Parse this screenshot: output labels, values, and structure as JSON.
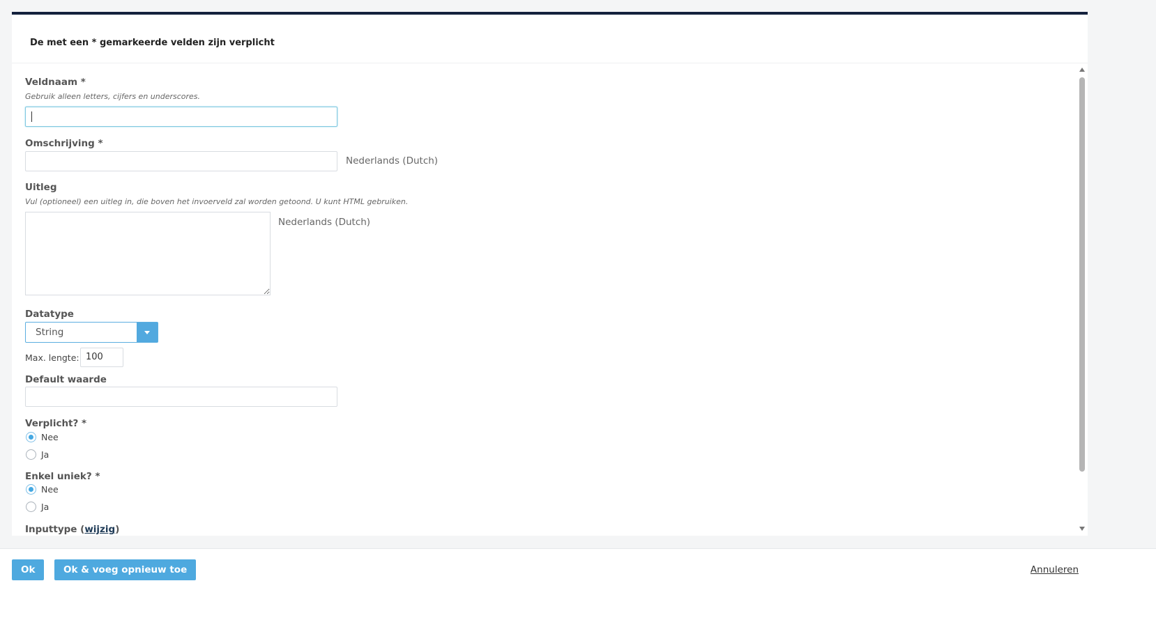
{
  "notice": "De met een * gemarkeerde velden zijn verplicht",
  "fields": {
    "veldnaam": {
      "label": "Veldnaam *",
      "help": "Gebruik alleen letters, cijfers en underscores.",
      "value": ""
    },
    "omschrijving": {
      "label": "Omschrijving *",
      "value": "",
      "language": "Nederlands (Dutch)"
    },
    "uitleg": {
      "label": "Uitleg",
      "help": "Vul (optioneel) een uitleg in, die boven het invoerveld zal worden getoond. U kunt HTML gebruiken.",
      "value": "",
      "language": "Nederlands (Dutch)"
    },
    "datatype": {
      "label": "Datatype",
      "selected": "String"
    },
    "max_lengte": {
      "label": "Max. lengte:",
      "value": "100"
    },
    "default_waarde": {
      "label": "Default waarde",
      "value": ""
    },
    "verplicht": {
      "label": "Verplicht? *",
      "options": [
        "Nee",
        "Ja"
      ],
      "selected": "Nee"
    },
    "enkel_uniek": {
      "label": "Enkel uniek? *",
      "options": [
        "Nee",
        "Ja"
      ],
      "selected": "Nee"
    },
    "inputtype": {
      "label": "Inputtype",
      "paren_open": "(",
      "link": "wijzig",
      "paren_close": ")"
    }
  },
  "footer": {
    "ok_label": "Ok",
    "ok_add_label": "Ok & voeg opnieuw toe",
    "cancel_label": "Annuleren"
  },
  "colors": {
    "accent": "#4ea9df",
    "header_border": "#14213d"
  }
}
